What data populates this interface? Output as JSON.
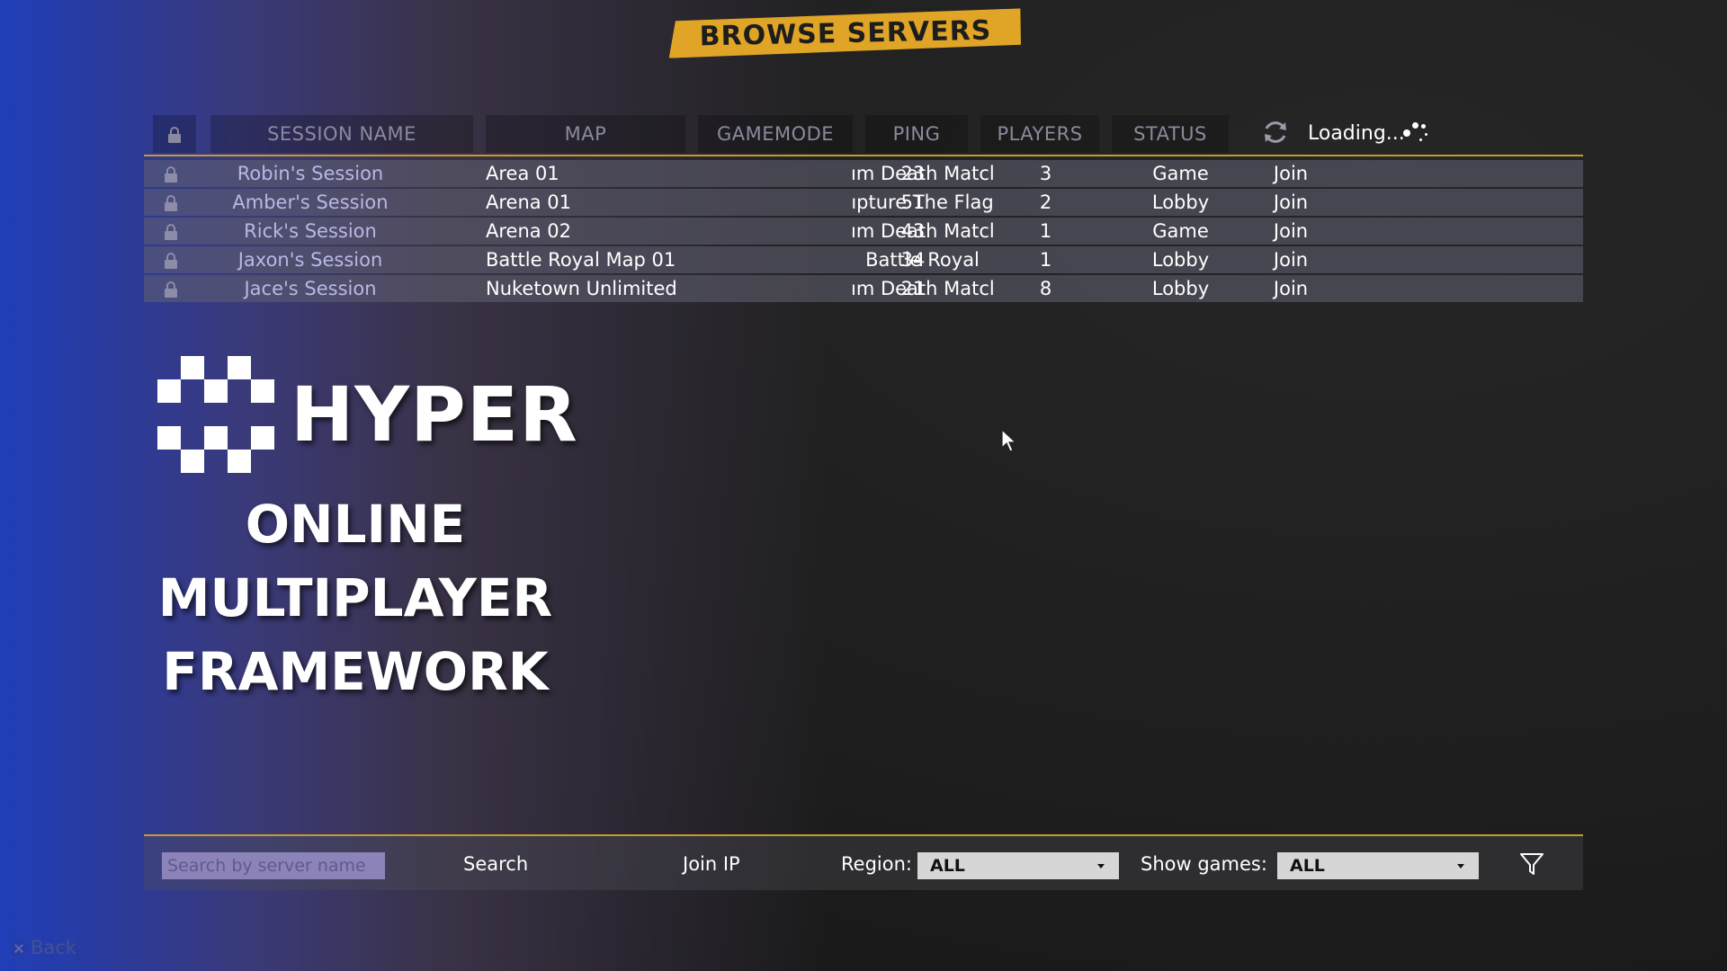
{
  "title": "BROWSE SERVERS",
  "columns": {
    "session_name": "SESSION NAME",
    "map": "MAP",
    "gamemode": "GAMEMODE",
    "ping": "PING",
    "players": "PLAYERS",
    "status": "STATUS"
  },
  "loading_text": "Loading...",
  "sessions": [
    {
      "name": "Robin's Session",
      "map": "Area 01",
      "gamemode": "ım Death Matcl",
      "ping": "23",
      "players": "3",
      "status": "Game",
      "join": "Join"
    },
    {
      "name": "Amber's Session",
      "map": "Arena 01",
      "gamemode": "ıpture The Flag",
      "ping": "51",
      "players": "2",
      "status": "Lobby",
      "join": "Join"
    },
    {
      "name": "Rick's Session",
      "map": "Arena 02",
      "gamemode": "ım Death Matcl",
      "ping": "43",
      "players": "1",
      "status": "Game",
      "join": "Join"
    },
    {
      "name": "Jaxon's Session",
      "map": "Battle Royal Map 01",
      "gamemode": "Battle Royal",
      "ping": "34",
      "players": "1",
      "status": "Lobby",
      "join": "Join"
    },
    {
      "name": "Jace's Session",
      "map": "Nuketown Unlimited",
      "gamemode": "ım Death Matcl",
      "ping": "21",
      "players": "8",
      "status": "Lobby",
      "join": "Join"
    }
  ],
  "logo": {
    "word": "HYPER",
    "tagline_lines": [
      "ONLINE",
      "MULTIPLAYER",
      "FRAMEWORK"
    ]
  },
  "bottom": {
    "search_placeholder": "Search by server name",
    "search_label": "Search",
    "join_ip_label": "Join IP",
    "region_label": "Region:",
    "region_value": "ALL",
    "show_games_label": "Show games:",
    "show_games_value": "ALL"
  },
  "back_label": "Back",
  "colors": {
    "accent": "#e0a526",
    "divider": "#c89a2b",
    "row_bg": "#5f5f70",
    "session_name": "#b8b8e6",
    "header_text": "#8a8a9e"
  },
  "icons": {
    "lock": "lock-icon",
    "refresh": "refresh-icon",
    "filter": "filter-icon",
    "cursor": "mouse-cursor-icon",
    "back": "close-icon"
  }
}
